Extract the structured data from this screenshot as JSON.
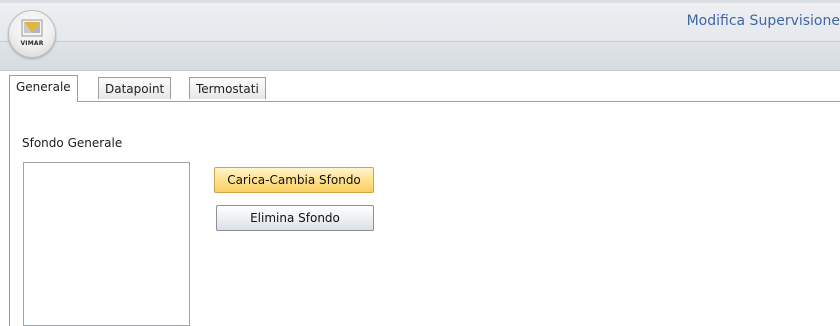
{
  "header": {
    "logo_text": "VIMAR",
    "title": "Modifica Supervisione"
  },
  "tabs": [
    {
      "label": "Generale",
      "active": true
    },
    {
      "label": "Datapoint",
      "active": false
    },
    {
      "label": "Termostati",
      "active": false
    }
  ],
  "content": {
    "section_label": "Sfondo Generale",
    "buttons": {
      "load_change": "Carica-Cambia Sfondo",
      "delete": "Elimina Sfondo"
    }
  },
  "colors": {
    "title_blue": "#3f66a6",
    "primary_button": "#ffe28d",
    "logo_gold": "#e2b53a"
  },
  "icons": {
    "logo": "vimar-logo-icon"
  }
}
